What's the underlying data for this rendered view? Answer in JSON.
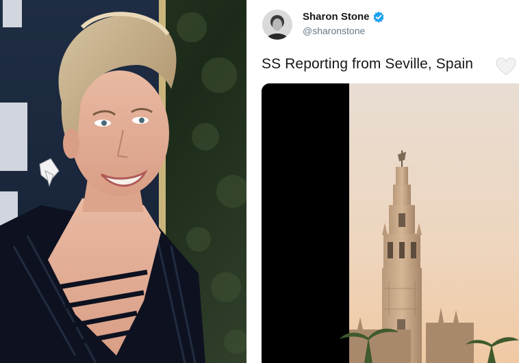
{
  "photo": {
    "description_icon": "portrait-photo",
    "backdrop_color": "#23331f"
  },
  "tweet": {
    "author_name": "Sharon Stone",
    "author_handle": "@sharonstone",
    "verified_icon": "verified-badge-icon",
    "text": "SS Reporting from Seville, Spain",
    "emoji": "white-heart",
    "media_icon": "video-frame"
  },
  "colors": {
    "verified_blue": "#1da1f2",
    "text_dark": "#14171a",
    "handle_gray": "#657786",
    "sky_top": "#e8ddd3",
    "sky_bottom": "#f0c9a3"
  }
}
